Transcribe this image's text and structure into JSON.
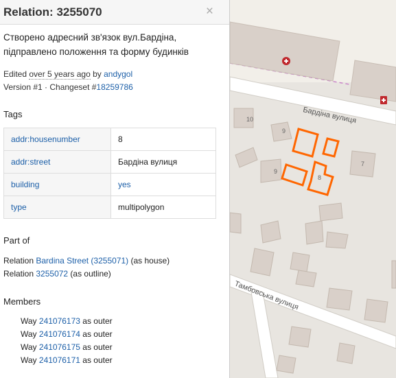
{
  "header": {
    "title": "Relation: 3255070",
    "close_glyph": "×"
  },
  "comment": "Створено адресний зв'язок вул.Бардіна, підправлено положення та форму будинків",
  "meta": {
    "edited_prefix": "Edited ",
    "edited_when": "over 5 years ago",
    "by_text": " by ",
    "user": "andygol",
    "version_text": "Version #1 · Changeset #",
    "changeset": "18259786"
  },
  "tags": {
    "heading": "Tags",
    "rows": [
      {
        "key": "addr:housenumber",
        "value": "8"
      },
      {
        "key": "addr:street",
        "value": "Бардіна вулиця"
      },
      {
        "key": "building",
        "value": "yes"
      },
      {
        "key": "type",
        "value": "multipolygon"
      }
    ]
  },
  "part_of": {
    "heading": "Part of",
    "items": [
      {
        "prefix": "Relation ",
        "link": "Bardina Street (3255071)",
        "suffix": " (as house)"
      },
      {
        "prefix": "Relation ",
        "link": "3255072",
        "suffix": " (as outline)"
      }
    ]
  },
  "members": {
    "heading": "Members",
    "items": [
      {
        "prefix": "Way ",
        "link": "241076173",
        "suffix": " as outer"
      },
      {
        "prefix": "Way ",
        "link": "241076174",
        "suffix": " as outer"
      },
      {
        "prefix": "Way ",
        "link": "241076175",
        "suffix": " as outer"
      },
      {
        "prefix": "Way ",
        "link": "241076171",
        "suffix": " as outer"
      }
    ]
  },
  "map": {
    "street_1": "Бардіна вулиця",
    "street_2": "Тамбовська вулиця",
    "house_labels": [
      "10",
      "9",
      "9",
      "8",
      "7"
    ],
    "highlight_color": "#ff6600",
    "icons": [
      "hospital-icon",
      "pharmacy-icon"
    ]
  }
}
